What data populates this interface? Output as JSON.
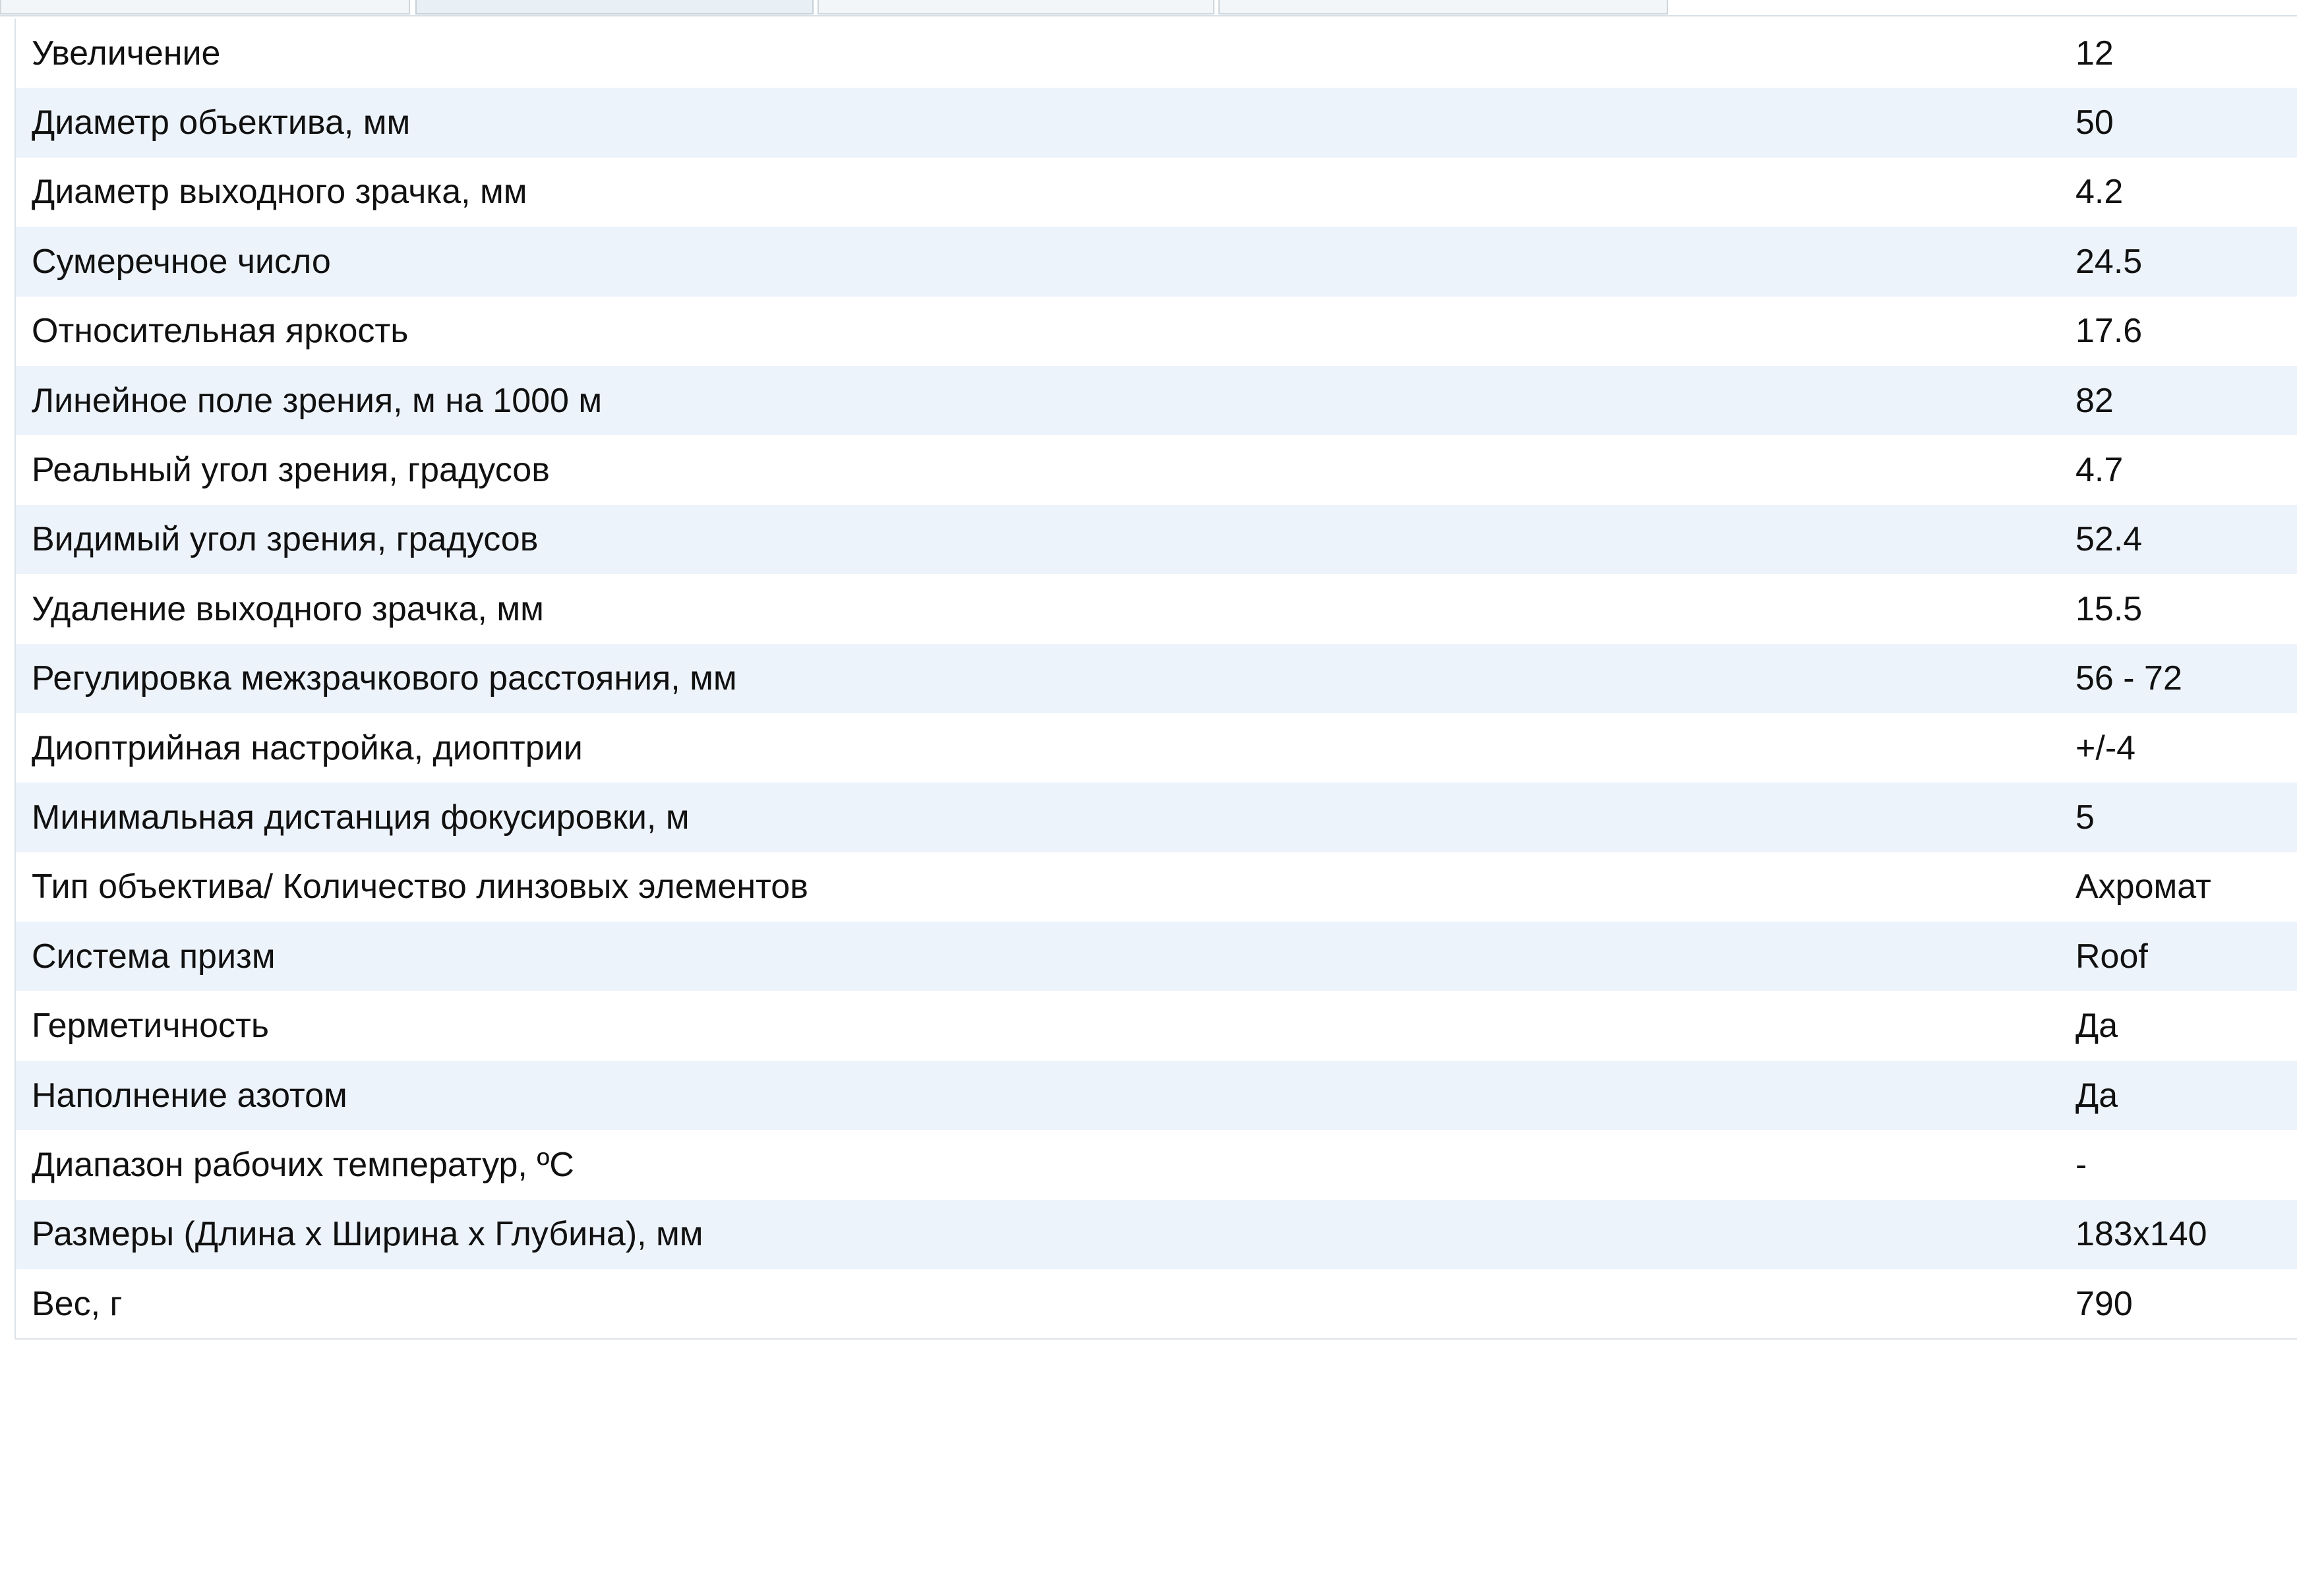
{
  "tabs": [
    {
      "label": "",
      "active": false
    },
    {
      "label": "",
      "active": true
    },
    {
      "label": "",
      "active": false
    },
    {
      "label": "",
      "active": false
    }
  ],
  "specs": [
    {
      "label": "Увеличение",
      "value": "12"
    },
    {
      "label": "Диаметр объектива, мм",
      "value": "50"
    },
    {
      "label": "Диаметр выходного зрачка, мм",
      "value": "4.2"
    },
    {
      "label": "Сумеречное число",
      "value": "24.5"
    },
    {
      "label": "Относительная яркость",
      "value": "17.6"
    },
    {
      "label": "Линейное поле зрения, м на 1000 м",
      "value": "82"
    },
    {
      "label": "Реальный угол зрения, градусов",
      "value": "4.7"
    },
    {
      "label": "Видимый угол зрения, градусов",
      "value": "52.4"
    },
    {
      "label": "Удаление выходного зрачка, мм",
      "value": "15.5"
    },
    {
      "label": "Регулировка межзрачкового расстояния, мм",
      "value": "56 - 72"
    },
    {
      "label": "Диоптрийная настройка, диоптрии",
      "value": "+/-4"
    },
    {
      "label": "Минимальная дистанция фокусировки, м",
      "value": "5"
    },
    {
      "label": "Тип объектива/ Количество линзовых элементов",
      "value": "Ахромат"
    },
    {
      "label": "Система призм",
      "value": "Roof"
    },
    {
      "label": "Герметичность",
      "value": "Да"
    },
    {
      "label": "Наполнение азотом",
      "value": "Да"
    },
    {
      "label": "Диапазон рабочих температур, ºС",
      "value": "-"
    },
    {
      "label": "Размеры (Длина х Ширина х Глубина), мм",
      "value": "183x140"
    },
    {
      "label": "Вес, г",
      "value": "790"
    }
  ],
  "colors": {
    "row_odd": "#ffffff",
    "row_even": "#edf3fb",
    "border": "#dde3e8"
  }
}
